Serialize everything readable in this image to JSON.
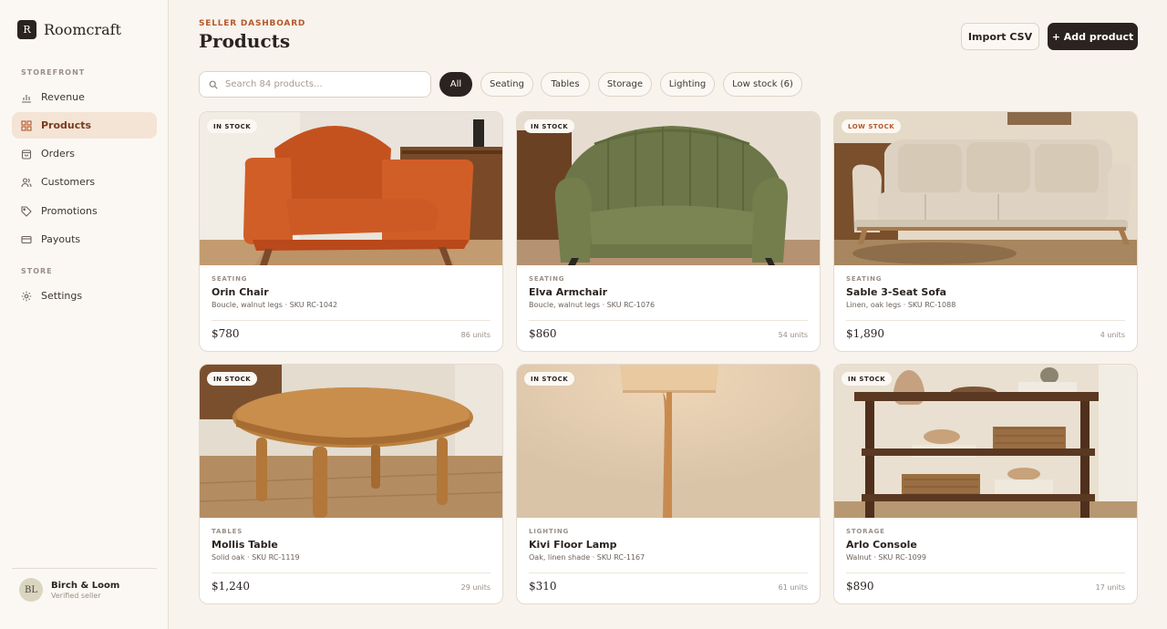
{
  "brand": {
    "mark": "R",
    "name": "Roomcraft"
  },
  "sidebar": {
    "sections": [
      {
        "title": "STOREFRONT"
      },
      {
        "title": "STORE"
      }
    ],
    "items": [
      {
        "label": "Revenue",
        "icon": "bar-chart-icon"
      },
      {
        "label": "Products",
        "icon": "grid-icon",
        "active": true
      },
      {
        "label": "Orders",
        "icon": "bag-icon"
      },
      {
        "label": "Customers",
        "icon": "users-icon"
      },
      {
        "label": "Promotions",
        "icon": "tag-icon"
      },
      {
        "label": "Payouts",
        "icon": "card-icon"
      },
      {
        "label": "Settings",
        "icon": "gear-icon"
      }
    ]
  },
  "profile": {
    "initials": "BL",
    "name": "Birch & Loom",
    "role": "Verified seller"
  },
  "header": {
    "eyebrow": "SELLER DASHBOARD",
    "title": "Products",
    "import_label": "Import CSV",
    "add_label": "+ Add product"
  },
  "search": {
    "placeholder": "Search 84 products...",
    "value": ""
  },
  "filters": [
    {
      "label": "All",
      "active": true
    },
    {
      "label": "Seating"
    },
    {
      "label": "Tables"
    },
    {
      "label": "Storage"
    },
    {
      "label": "Lighting"
    },
    {
      "label": "Low stock (6)"
    }
  ],
  "products": [
    {
      "badge": "IN STOCK",
      "category": "SEATING",
      "name": "Orin Chair",
      "meta": "Boucle, walnut legs · SKU RC-1042",
      "price": "$780",
      "units": "86 units"
    },
    {
      "badge": "IN STOCK",
      "category": "SEATING",
      "name": "Elva Armchair",
      "meta": "Boucle, walnut legs · SKU RC-1076",
      "price": "$860",
      "units": "54 units"
    },
    {
      "badge": "LOW STOCK",
      "category": "SEATING",
      "name": "Sable 3-Seat Sofa",
      "meta": "Linen, oak legs · SKU RC-1088",
      "price": "$1,890",
      "units": "4 units"
    },
    {
      "badge": "IN STOCK",
      "category": "TABLES",
      "name": "Mollis Table",
      "meta": "Solid oak · SKU RC-1119",
      "price": "$1,240",
      "units": "29 units"
    },
    {
      "badge": "IN STOCK",
      "category": "LIGHTING",
      "name": "Kivi Floor Lamp",
      "meta": "Oak, linen shade · SKU RC-1167",
      "price": "$310",
      "units": "61 units"
    },
    {
      "badge": "IN STOCK",
      "category": "STORAGE",
      "name": "Arlo Console",
      "meta": "Walnut · SKU RC-1099",
      "price": "$890",
      "units": "17 units"
    }
  ],
  "colors": {
    "accent": "#b5582a",
    "dark": "#2a2320",
    "background": "#f8f3ec",
    "active_nav": "#f4e4d6"
  }
}
